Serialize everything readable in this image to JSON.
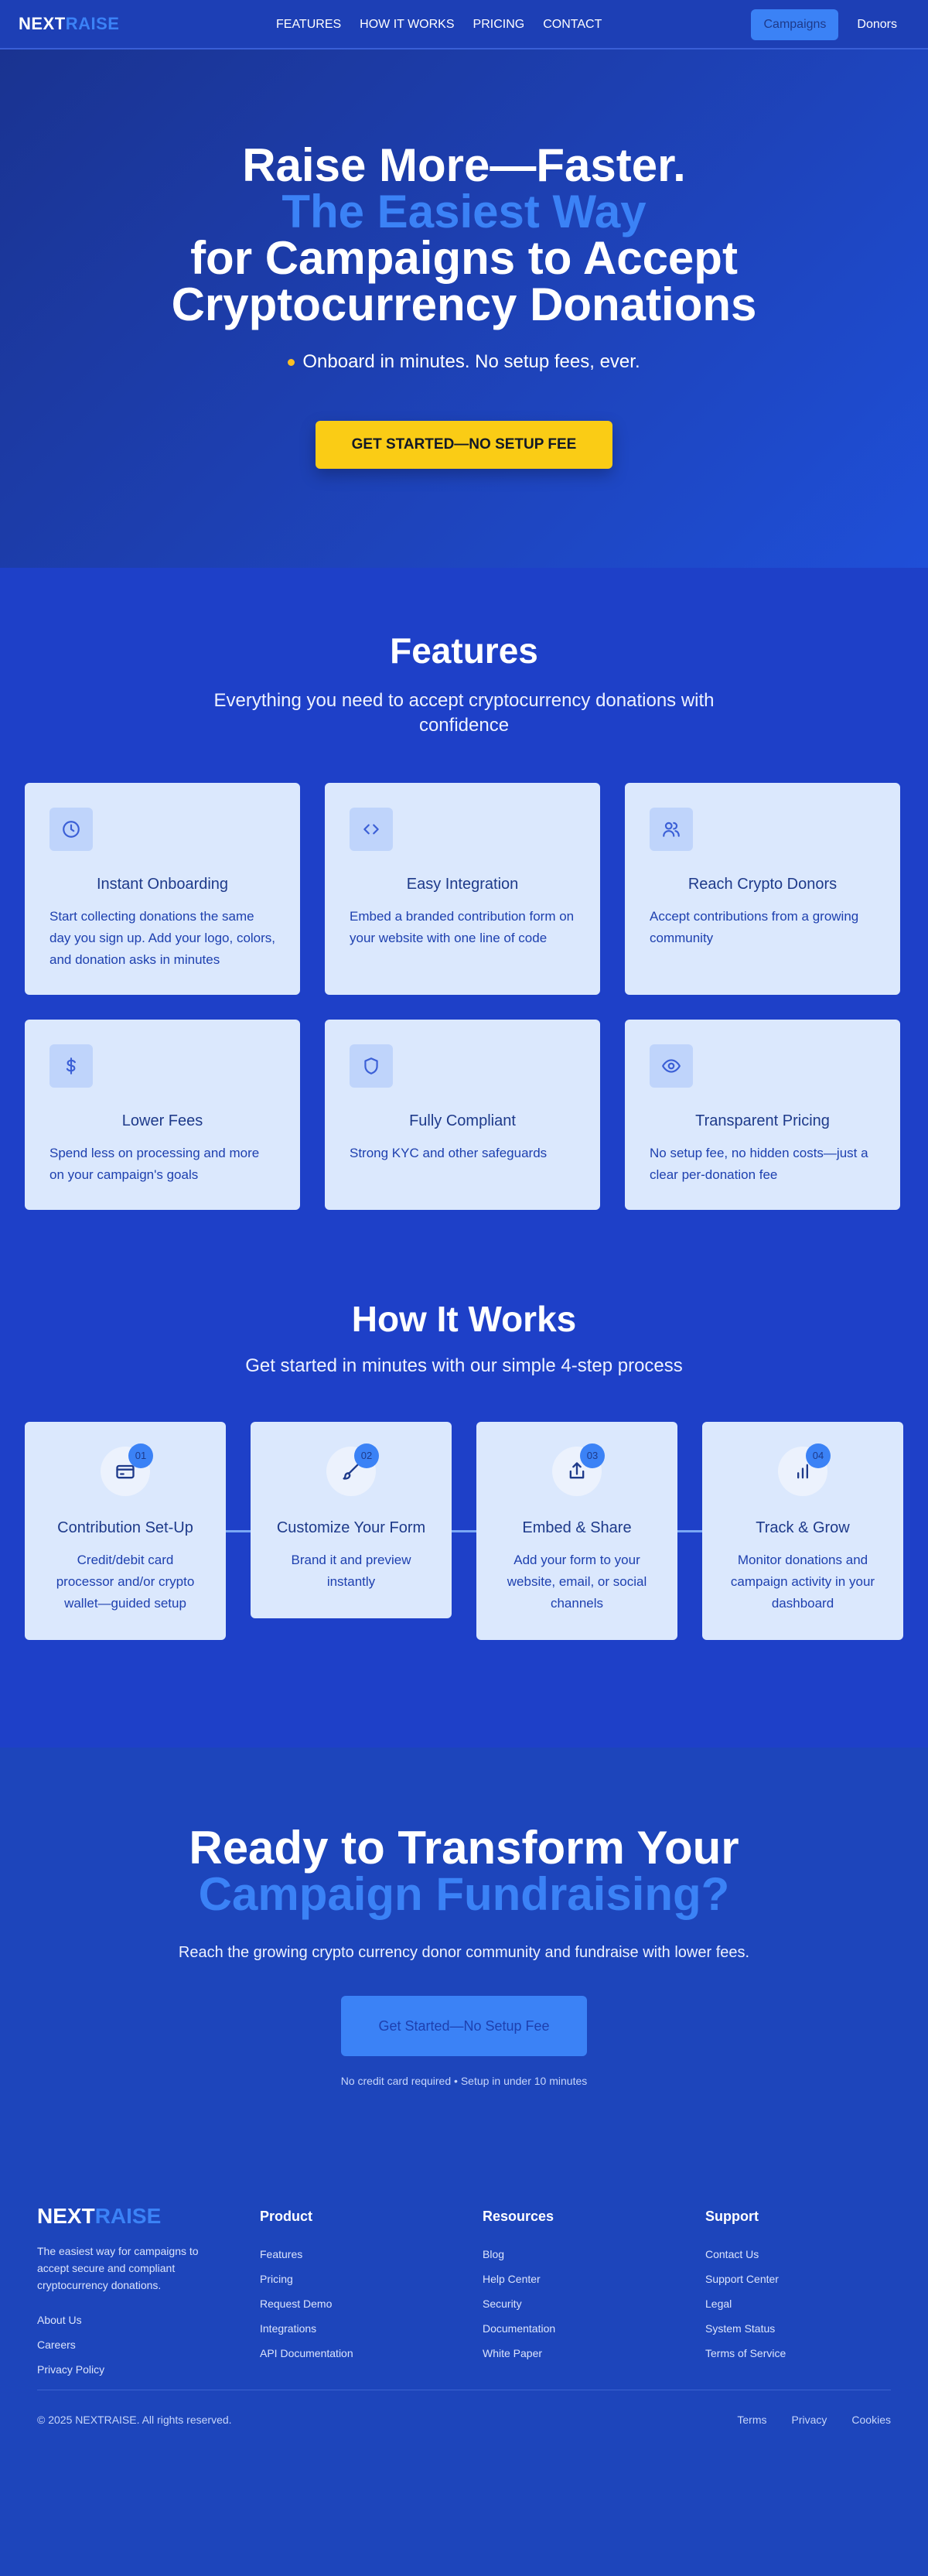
{
  "nav": {
    "logo_a": "NEXT",
    "logo_b": "RAISE",
    "links": [
      "FEATURES",
      "HOW IT WORKS",
      "PRICING",
      "CONTACT"
    ],
    "campaigns": "Campaigns",
    "donors": "Donors"
  },
  "hero": {
    "line1": "Raise More—Faster.",
    "line2": "The Easiest Way",
    "line3": "for Campaigns to Accept",
    "line4": "Cryptocurrency Donations",
    "tagline": "Onboard in minutes. No setup fees, ever.",
    "cta": "GET STARTED—NO SETUP FEE"
  },
  "features": {
    "title": "Features",
    "subtitle": "Everything you need to accept cryptocurrency donations with confidence",
    "items": [
      {
        "icon": "clock-icon",
        "title": "Instant Onboarding",
        "desc": "Start collecting donations the same day you sign up. Add your logo, colors, and donation asks in minutes"
      },
      {
        "icon": "code-icon",
        "title": "Easy Integration",
        "desc": "Embed a branded contribution form on your website with one line of code"
      },
      {
        "icon": "users-icon",
        "title": "Reach Crypto Donors",
        "desc": "Accept contributions from a growing community"
      },
      {
        "icon": "dollar-icon",
        "title": "Lower Fees",
        "desc": "Spend less on processing and more on your campaign's goals"
      },
      {
        "icon": "shield-icon",
        "title": "Fully Compliant",
        "desc": "Strong KYC and other safeguards"
      },
      {
        "icon": "eye-icon",
        "title": "Transparent Pricing",
        "desc": "No setup fee, no hidden costs—just a clear per-donation fee"
      }
    ]
  },
  "how": {
    "title": "How It Works",
    "subtitle": "Get started in minutes with our simple 4-step process",
    "steps": [
      {
        "num": "01",
        "icon": "credit-card-icon",
        "title": "Contribution Set-Up",
        "desc": "Credit/debit card processor and/or crypto wallet—guided setup"
      },
      {
        "num": "02",
        "icon": "brush-icon",
        "title": "Customize Your Form",
        "desc": "Brand it and preview instantly"
      },
      {
        "num": "03",
        "icon": "share-icon",
        "title": "Embed & Share",
        "desc": "Add your form to your website, email, or social channels"
      },
      {
        "num": "04",
        "icon": "bar-chart-icon",
        "title": "Track & Grow",
        "desc": "Monitor donations and campaign activity in your dashboard"
      }
    ]
  },
  "ready": {
    "line1": "Ready to Transform Your",
    "line2": "Campaign Fundraising?",
    "subtitle": "Reach the growing crypto currency donor community and fundraise with lower fees.",
    "cta": "Get Started—No Setup Fee",
    "note": "No credit card required • Setup in under 10 minutes"
  },
  "footer": {
    "logo_a": "NEXT",
    "logo_b": "RAISE",
    "about": "The easiest way for campaigns to accept secure and compliant cryptocurrency donations.",
    "company_links": [
      "About Us",
      "Careers",
      "Privacy Policy"
    ],
    "product": {
      "title": "Product",
      "links": [
        "Features",
        "Pricing",
        "Request Demo",
        "Integrations",
        "API Documentation"
      ]
    },
    "resources": {
      "title": "Resources",
      "links": [
        "Blog",
        "Help Center",
        "Security",
        "Documentation",
        "White Paper"
      ]
    },
    "support": {
      "title": "Support",
      "links": [
        "Contact Us",
        "Support Center",
        "Legal",
        "System Status",
        "Terms of Service"
      ]
    },
    "copyright": "© 2025 NEXTRAISE. All rights reserved.",
    "legal": [
      "Terms",
      "Privacy",
      "Cookies"
    ]
  },
  "colors": {
    "accent": "#3b82f6",
    "cta_yellow": "#facc15",
    "bg": "#1e40c8",
    "card": "#dbe8fd"
  }
}
